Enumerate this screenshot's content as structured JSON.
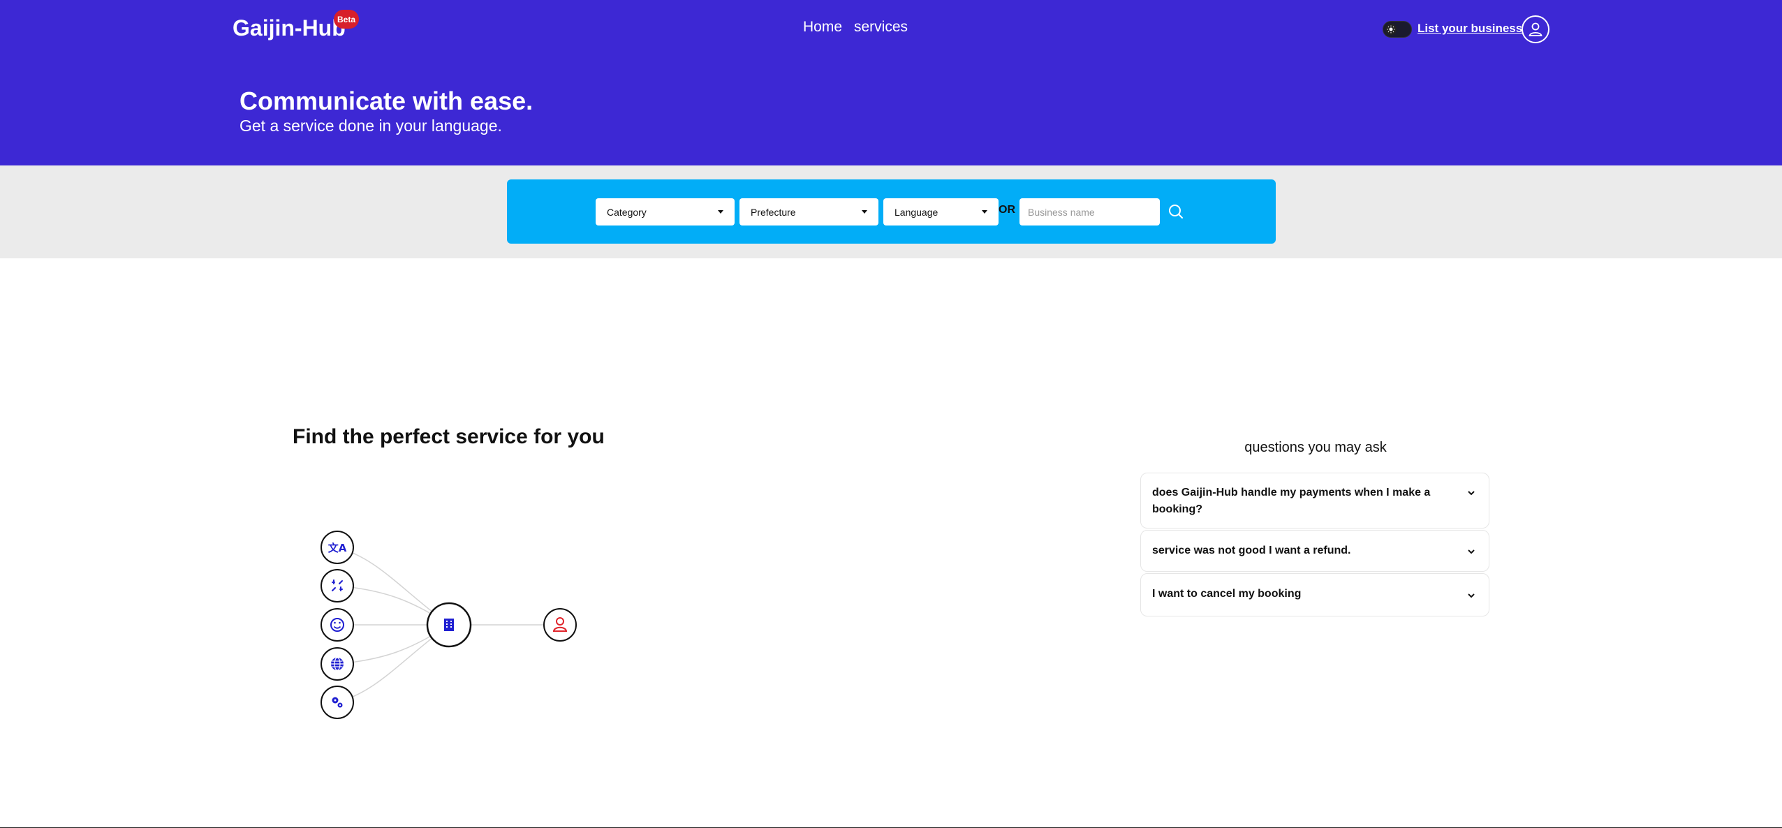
{
  "header": {
    "logo": "Gaijin-Hub",
    "beta_badge": "Beta",
    "nav": [
      {
        "label": "Home"
      },
      {
        "label": "services"
      }
    ],
    "list_business_label": "List your business",
    "theme_toggle_icon": "sun-icon",
    "account_icon": "user-icon",
    "background_color": "#3d28d4"
  },
  "hero": {
    "title": "Communicate with ease.",
    "subtitle": "Get a service done in your language."
  },
  "search": {
    "category_label": "Category",
    "prefecture_label": "Prefecture",
    "language_label": "Language",
    "or_label": "OR",
    "business_placeholder": "Business name",
    "search_icon": "search-icon",
    "box_color": "#02adf7"
  },
  "main": {
    "title": "Find the perfect service for you",
    "diagram": {
      "left_icons": [
        "translate-icon",
        "broken-link-icon",
        "smile-icon",
        "globe-icon",
        "gears-icon"
      ],
      "center_icon": "building-icon",
      "right_icon": "user-icon",
      "accent_color": "#1f1fd1",
      "user_color": "#e0242b"
    }
  },
  "faq": {
    "title": "questions you may ask",
    "items": [
      {
        "question": "does Gaijin-Hub handle my payments when I make a booking?"
      },
      {
        "question": "service was not good I want a refund."
      },
      {
        "question": "I want to cancel my booking"
      }
    ]
  }
}
